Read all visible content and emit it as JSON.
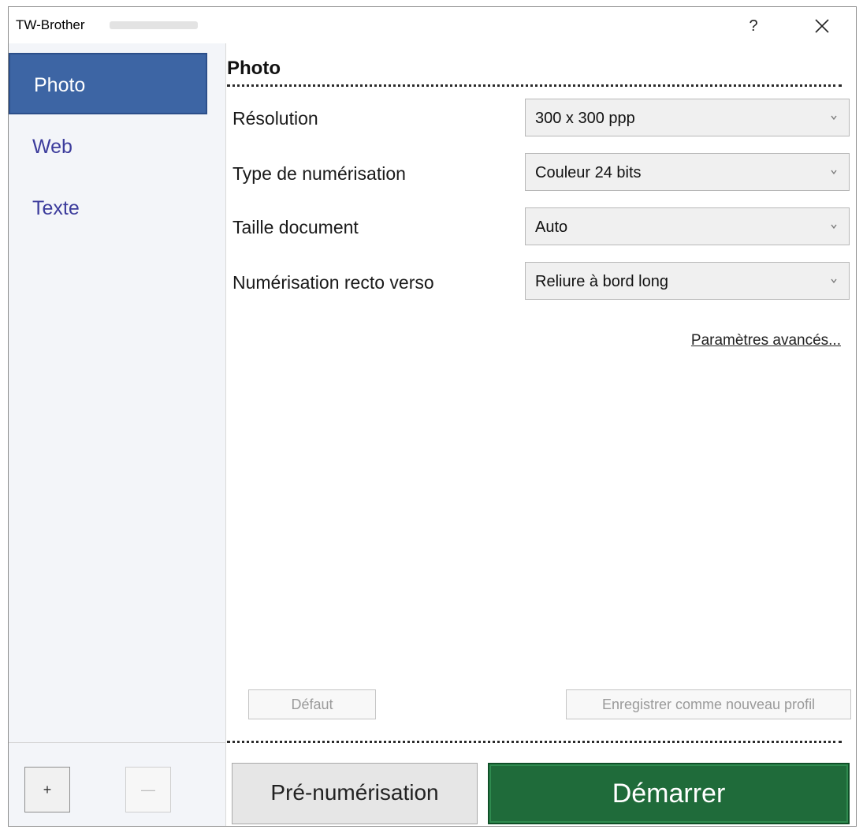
{
  "window": {
    "title": "TW-Brother",
    "help_label": "?",
    "close_icon": "close-icon"
  },
  "sidebar": {
    "items": [
      {
        "label": "Photo",
        "active": true
      },
      {
        "label": "Web",
        "active": false
      },
      {
        "label": "Texte",
        "active": false
      }
    ],
    "add_label": "+",
    "remove_label": "—"
  },
  "main": {
    "section_title": "Photo",
    "settings": [
      {
        "label": "Résolution",
        "value": "300 x 300 ppp"
      },
      {
        "label": "Type de numérisation",
        "value": "Couleur 24 bits"
      },
      {
        "label": "Taille document",
        "value": "Auto"
      },
      {
        "label": "Numérisation recto verso",
        "value": "Reliure à bord long"
      }
    ],
    "advanced_link": "Paramètres avancés...",
    "default_button": "Défaut",
    "save_profile_button": "Enregistrer comme nouveau profil",
    "prescan_button": "Pré-numérisation",
    "start_button": "Démarrer"
  },
  "colors": {
    "sidebar_active": "#3d65a4",
    "start_button": "#1f6b3a",
    "sidebar_text": "#3c3c9c"
  }
}
